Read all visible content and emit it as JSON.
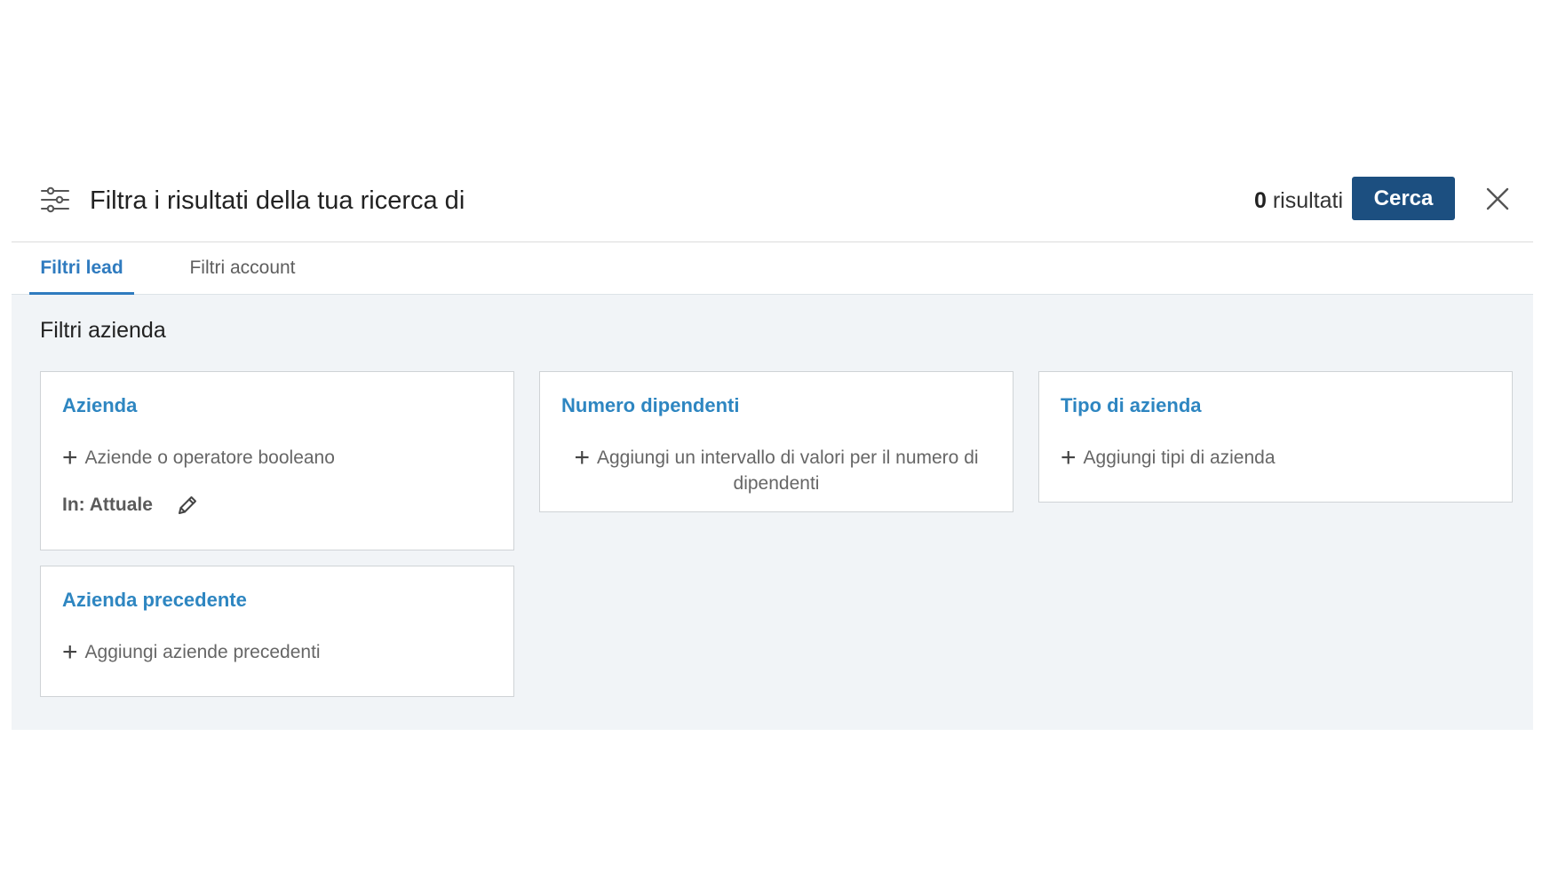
{
  "header": {
    "icon": "sliders-icon",
    "title": "Filtra i risultati della tua ricerca di",
    "results_count": "0",
    "results_label": "risultati",
    "search_button": "Cerca",
    "close_icon": "close-icon"
  },
  "tabs": [
    {
      "label": "Filtri lead",
      "active": true
    },
    {
      "label": "Filtri account",
      "active": false
    }
  ],
  "section": {
    "title": "Filtri azienda"
  },
  "cards": {
    "azienda": {
      "title": "Azienda",
      "add_label": "Aziende o operatore booleano",
      "scope_label": "In: Attuale"
    },
    "dipendenti": {
      "title": "Numero dipendenti",
      "add_label": "Aggiungi un intervallo di valori per il numero di dipendenti"
    },
    "tipo": {
      "title": "Tipo di azienda",
      "add_label": "Aggiungi tipi di azienda"
    },
    "precedente": {
      "title": "Azienda precedente",
      "add_label": "Aggiungi aziende precedenti"
    }
  },
  "colors": {
    "primary_button": "#1c4f80",
    "link": "#2e86c1",
    "active_tab": "#2f7bbf",
    "content_bg": "#f1f4f7"
  }
}
